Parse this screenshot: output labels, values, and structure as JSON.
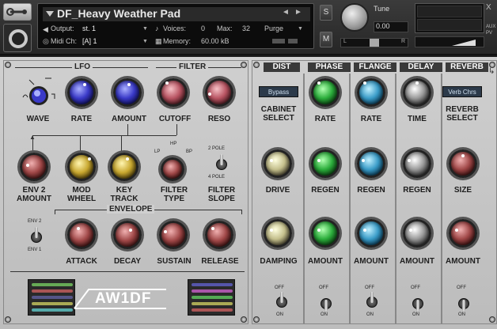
{
  "header": {
    "instrument_name": "DF_Heavy Weather Pad",
    "output_label": "Output:",
    "output_value": "st. 1",
    "voices_label": "Voices:",
    "voices_value": "0",
    "max_label": "Max:",
    "max_value": "32",
    "purge_label": "Purge",
    "midi_label": "Midi Ch:",
    "midi_value": "[A]  1",
    "memory_label": "Memory:",
    "memory_value": "60.00 kB",
    "s_label": "S",
    "m_label": "M",
    "tune_label": "Tune",
    "tune_value": "0.00",
    "pan_l": "L",
    "pan_r": "R",
    "aux_label": "AUX",
    "pv_label": "PV",
    "close_label": "X"
  },
  "left_panel": {
    "lfo_title": "LFO",
    "filter_title": "FILTER",
    "envelope_title": "ENVELOPE",
    "wave_label": "WAVE",
    "rate_label": "RATE",
    "amount_label": "AMOUNT",
    "cutoff_label": "CUTOFF",
    "reso_label": "RESO",
    "env2_label1": "ENV 2",
    "env2_label2": "AMOUNT",
    "mod_label1": "MOD",
    "mod_label2": "WHEEL",
    "key_label1": "KEY",
    "key_label2": "TRACK",
    "ftype_label1": "FILTER",
    "ftype_label2": "TYPE",
    "fslope_label1": "FILTER",
    "fslope_label2": "SLOPE",
    "lp": "LP",
    "hp": "HP",
    "bp": "BP",
    "two_pole": "2 POLE",
    "four_pole": "4 POLE",
    "env2": "ENV 2",
    "env1": "ENV 1",
    "attack_label": "ATTACK",
    "decay_label": "DECAY",
    "sustain_label": "SUSTAIN",
    "release_label": "RELEASE",
    "logo_text": "AW1DF"
  },
  "right_panel": {
    "dist_title": "DIST",
    "phase_title": "PHASE",
    "flange_title": "FLANGE",
    "delay_title": "DELAY",
    "reverb_title": "REVERB",
    "cabinet_value": "Bypass",
    "cabinet_label1": "CABINET",
    "cabinet_label2": "SELECT",
    "reverb_value": "Verb Chrs",
    "reverb_label1": "REVERB",
    "reverb_label2": "SELECT",
    "rate1": "RATE",
    "rate2": "RATE",
    "time": "TIME",
    "drive": "DRIVE",
    "regen1": "REGEN",
    "regen2": "REGEN",
    "regen3": "REGEN",
    "size": "SIZE",
    "damping": "DAMPING",
    "amount1": "AMOUNT",
    "amount2": "AMOUNT",
    "amount3": "AMOUNT",
    "amount4": "AMOUNT",
    "off": "OFF",
    "on": "ON"
  }
}
